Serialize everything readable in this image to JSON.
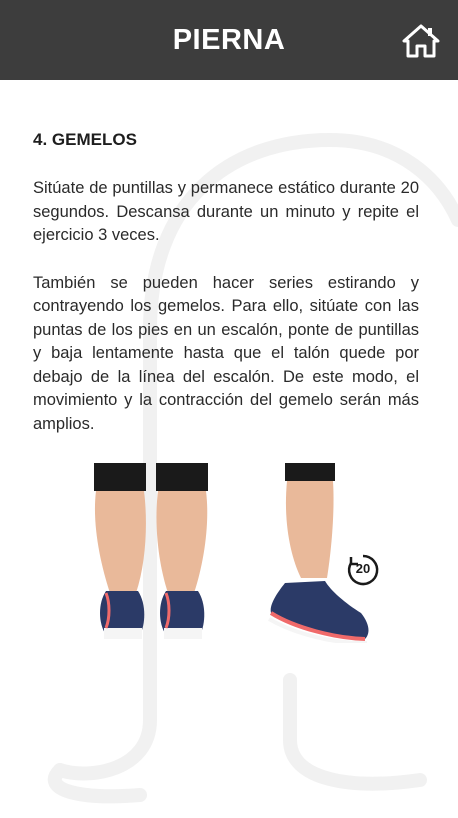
{
  "header": {
    "title": "PIERNA",
    "home_icon": "home-icon",
    "background": "#3d3d3d"
  },
  "content": {
    "section_title": "4. GEMELOS",
    "paragraphs": [
      "Sitúate de puntillas y permanece estático durante 20 segundos. Descansa durante un minuto y repite el ejercicio 3 veces.",
      "También se pueden hacer series estirando y contrayendo los gemelos. Para ello, sitúate con las puntas de los pies en un escalón, ponte de puntillas y baja lentamente hasta que el talón quede por debajo de la línea del escalón. De este modo, el movimiento y la contracción del gemelo serán más amplios."
    ]
  },
  "illustration": {
    "timer_value": "20",
    "timer_icon": "timer-icon",
    "shoe_color": "#2b3a67",
    "sole_accent": "#f06a6a"
  }
}
